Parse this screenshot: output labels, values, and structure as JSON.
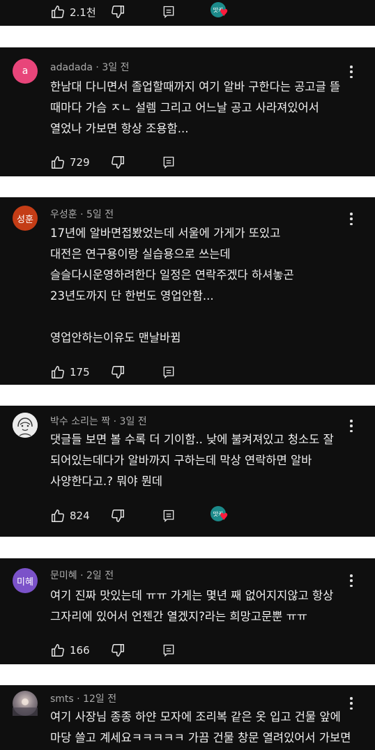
{
  "top_bar": {
    "likes": "2.1천",
    "creator_badge": "맛카"
  },
  "comments": [
    {
      "author": "adadada",
      "time": "3일 전",
      "avatar_text": "a",
      "avatar_color": "#e8457a",
      "lines": [
        "한남대 다니면서 졸업할때까지 여기 알바 구한다는 공고글 뜰",
        "때마다 가슴 ㅈㄴ 설렘 그리고 어느날 공고 사라져있어서",
        "열었나 가보면 항상 조용함..."
      ],
      "likes": "729"
    },
    {
      "author": "우성훈",
      "time": "5일 전",
      "avatar_text": "성훈",
      "avatar_color": "#c43d16",
      "lines": [
        "17년에 알바면접봤었는데 서울에 가게가 또있고",
        "대전은 연구용이랑 실습용으로 쓰는데",
        "슬슬다시운영하려한다 일정은 연락주겠다 하셔놓곤",
        "23년도까지 단 한번도 영업안함...",
        "",
        "영업안하는이유도 맨날바뀜"
      ],
      "likes": "175"
    },
    {
      "author": "박수 소리는 짝",
      "time": "3일 전",
      "avatar_text": "",
      "avatar_color": "#e6e6e6",
      "lines": [
        "댓글들 보면 볼 수록 더 기이함.. 낮에 불켜져있고 청소도 잘",
        "되어있는데다가 알바까지 구하는데 막상 연락하면 알바",
        "사양한다고.? 뭐야 뭔데"
      ],
      "likes": "824",
      "creator_badge": "맛카"
    },
    {
      "author": "문미혜",
      "time": "2일 전",
      "avatar_text": "미혜",
      "avatar_color": "#7b52c9",
      "lines": [
        "여기 진짜 맛있는데 ㅠㅠ 가게는 몇년 째 없어지지않고 항상",
        "그자리에 있어서 언젠간 열겠지?라는 희망고문뿐 ㅠㅠ"
      ],
      "likes": "166"
    },
    {
      "author": "smts",
      "time": "12일 전",
      "avatar_text": "",
      "avatar_color": "#8a7f86",
      "lines": [
        "여기 사장님 종종 하얀 모자에 조리복 같은 옷 입고 건물 앞에",
        "마당 쓸고 계세요ㅋㅋㅋㅋㅋ 가끔 건물 창문 열려있어서 가보면"
      ]
    }
  ]
}
